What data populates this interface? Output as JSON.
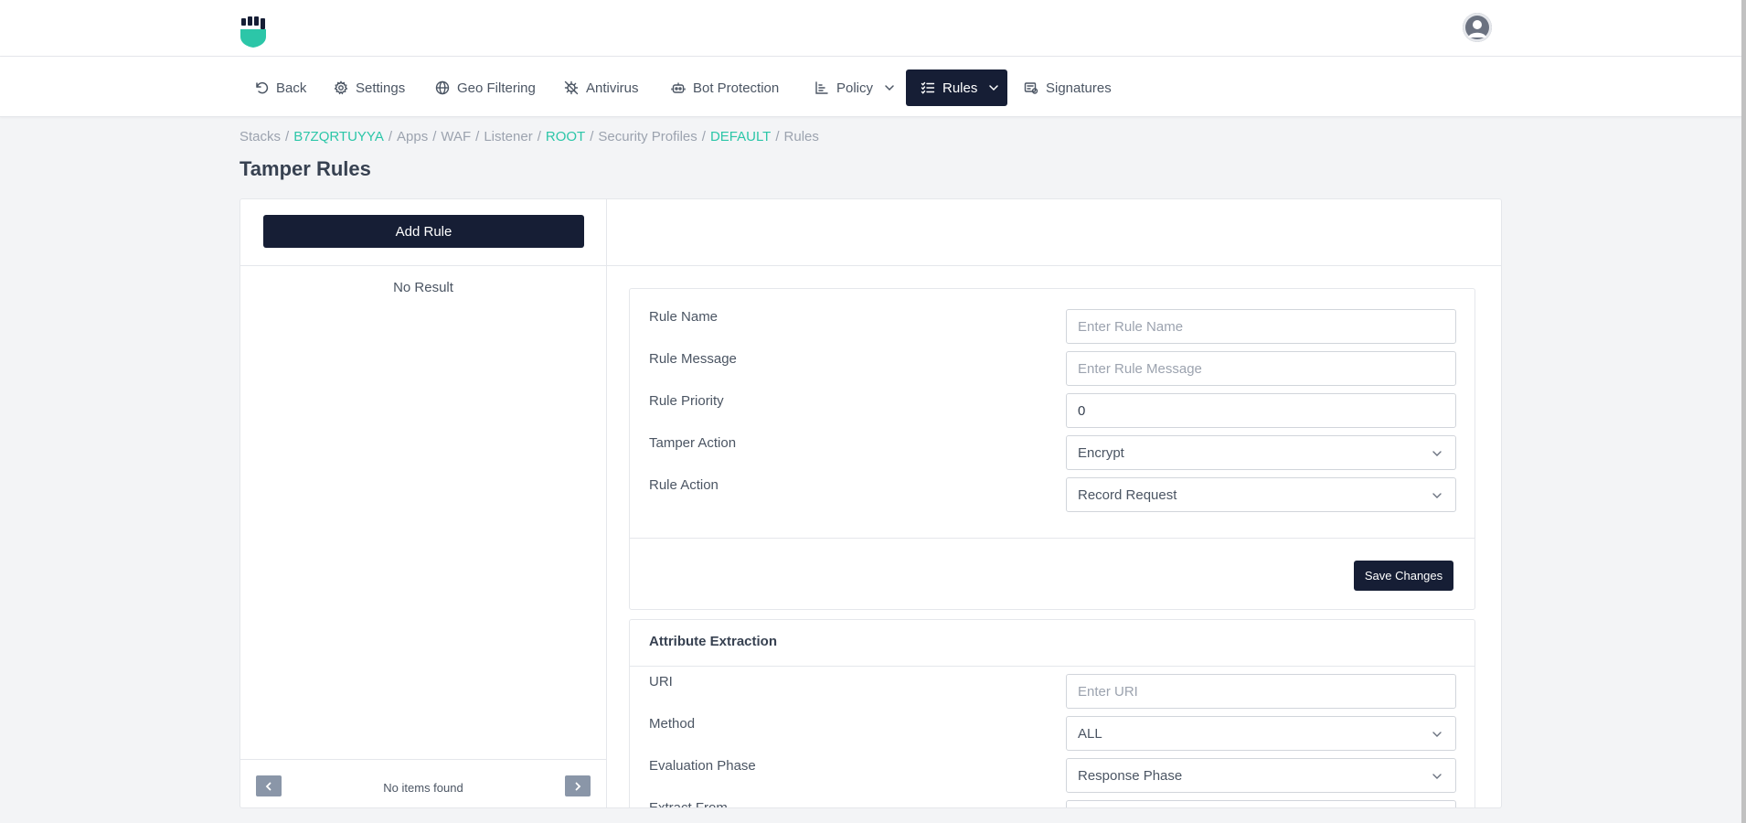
{
  "header": {
    "logo_icon": "fist-shield-icon",
    "avatar_icon": "user-avatar-icon",
    "brand_color": "#2cc6a8"
  },
  "nav": {
    "back": "Back",
    "settings": "Settings",
    "geo_filtering": "Geo Filtering",
    "antivirus": "Antivirus",
    "bot_protection": "Bot Protection",
    "policy": "Policy",
    "rules": "Rules",
    "signatures": "Signatures"
  },
  "breadcrumb": {
    "stacks": "Stacks",
    "stack_id": "B7ZQRTUYYA",
    "apps": "Apps",
    "waf": "WAF",
    "listener": "Listener",
    "root": "ROOT",
    "security_profiles": "Security Profiles",
    "default": "DEFAULT",
    "rules": "Rules",
    "separator": "/"
  },
  "page": {
    "title": "Tamper Rules"
  },
  "list": {
    "add_rule": "Add Rule",
    "no_result": "No Result",
    "no_items": "No items found"
  },
  "form": {
    "rule_name": {
      "label": "Rule Name",
      "placeholder": "Enter Rule Name"
    },
    "rule_message": {
      "label": "Rule Message",
      "placeholder": "Enter Rule Message"
    },
    "rule_priority": {
      "label": "Rule Priority",
      "value": "0"
    },
    "tamper_action": {
      "label": "Tamper Action",
      "value": "Encrypt"
    },
    "rule_action": {
      "label": "Rule Action",
      "value": "Record Request"
    },
    "save": "Save Changes"
  },
  "attribute_extraction": {
    "title": "Attribute Extraction",
    "uri": {
      "label": "URI",
      "placeholder": "Enter URI"
    },
    "method": {
      "label": "Method",
      "value": "ALL"
    },
    "evaluation_phase": {
      "label": "Evaluation Phase",
      "value": "Response Phase"
    },
    "extract_from": {
      "label": "Extract From"
    }
  }
}
